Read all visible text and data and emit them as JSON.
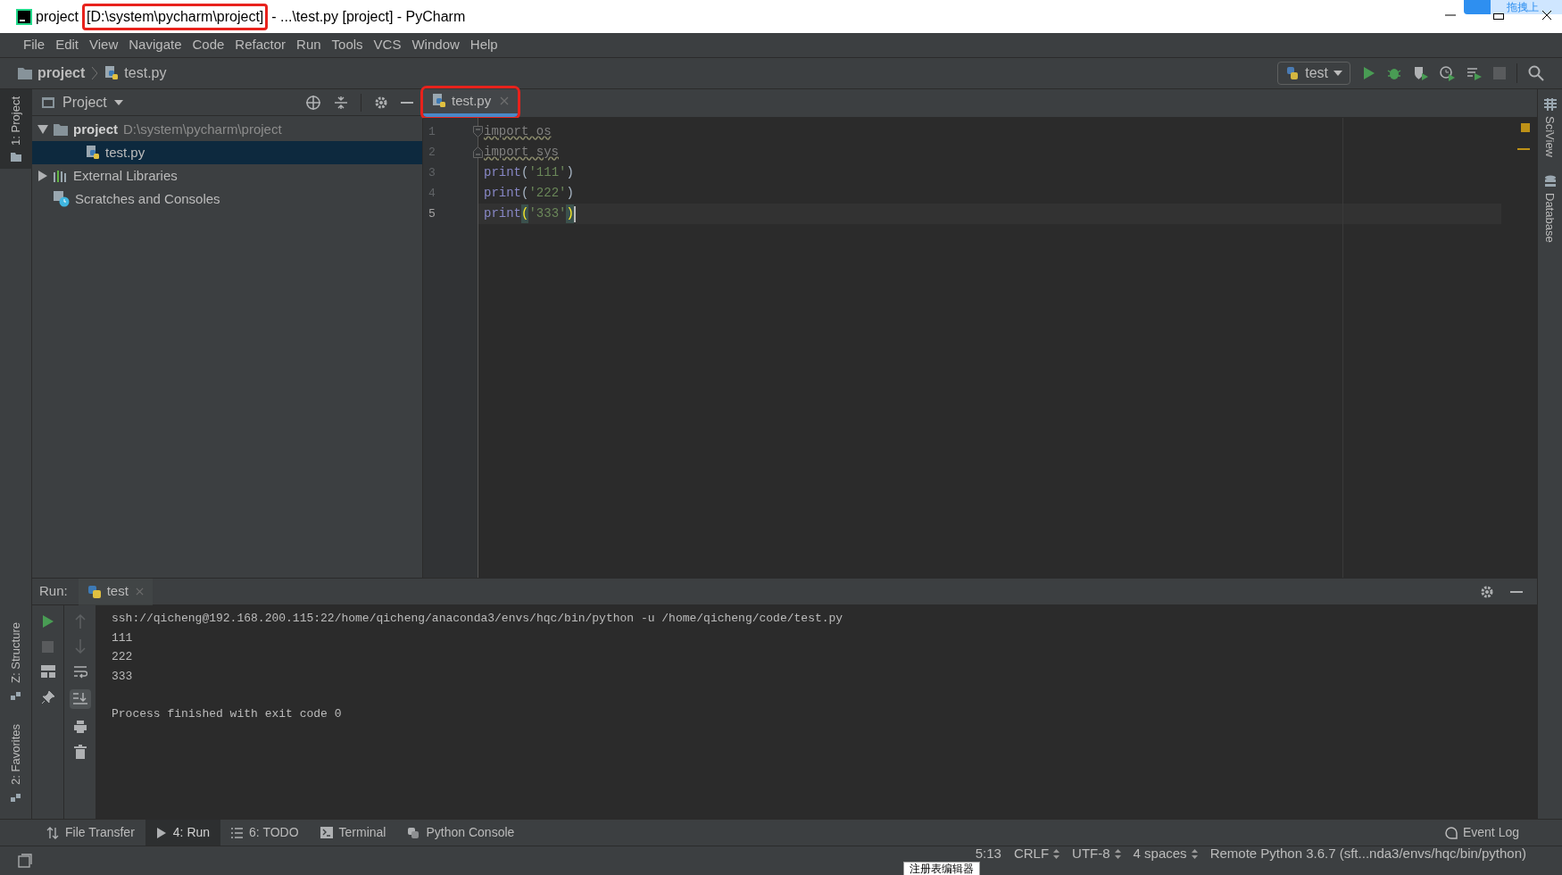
{
  "window": {
    "title": [
      {
        "text": "project",
        "highlighted": false
      },
      {
        "text": "[D:\\system\\pycharm\\project]",
        "highlighted": true
      },
      {
        "text": "- ...\\test.py [project] - PyCharm",
        "highlighted": false
      }
    ]
  },
  "overlay_widget": {
    "label": "拖拽上"
  },
  "menu": [
    "File",
    "Edit",
    "View",
    "Navigate",
    "Code",
    "Refactor",
    "Run",
    "Tools",
    "VCS",
    "Window",
    "Help"
  ],
  "breadcrumbs": [
    {
      "kind": "folder",
      "label": "project"
    },
    {
      "kind": "python",
      "label": "test.py"
    }
  ],
  "run_config": {
    "label": "test"
  },
  "left_stripe_top": [
    {
      "label": "1: Project",
      "selected": true
    }
  ],
  "left_stripe_bottom": [
    {
      "label": "Z: Structure",
      "selected": false
    },
    {
      "label": "2: Favorites",
      "selected": false
    }
  ],
  "right_stripe": [
    {
      "label": "SciView",
      "kind": "grid"
    },
    {
      "label": "Database",
      "kind": "db"
    }
  ],
  "project_panel": {
    "title": "Project",
    "tree": [
      {
        "kind": "folder",
        "label": "project",
        "path": "D:\\system\\pycharm\\project",
        "expanded": true,
        "selected": false,
        "children": [
          {
            "kind": "python",
            "label": "test.py",
            "selected": true
          }
        ]
      },
      {
        "kind": "library",
        "label": "External Libraries",
        "expanded": false,
        "selected": false
      },
      {
        "kind": "scratch",
        "label": "Scratches and Consoles",
        "selected": false
      }
    ]
  },
  "editor": {
    "tabs": [
      {
        "label": "test.py",
        "selected": true,
        "highlighted": true
      }
    ],
    "lines": [
      {
        "number": "1",
        "kind": "fold-start",
        "current": false,
        "tokens": [
          {
            "kind": "unused",
            "text": "import os"
          }
        ]
      },
      {
        "number": "2",
        "kind": "fold-end",
        "current": false,
        "tokens": [
          {
            "kind": "unused",
            "text": "import sys"
          }
        ]
      },
      {
        "number": "3",
        "current": false,
        "tokens": [
          {
            "kind": "func",
            "text": "print"
          },
          {
            "kind": "punct",
            "text": "("
          },
          {
            "kind": "string",
            "text": "'111'"
          },
          {
            "kind": "punct",
            "text": ")"
          }
        ]
      },
      {
        "number": "4",
        "current": false,
        "tokens": [
          {
            "kind": "func",
            "text": "print"
          },
          {
            "kind": "punct",
            "text": "("
          },
          {
            "kind": "string",
            "text": "'222'"
          },
          {
            "kind": "punct",
            "text": ")"
          }
        ]
      },
      {
        "number": "5",
        "current": true,
        "tokens": [
          {
            "kind": "func",
            "text": "print"
          },
          {
            "kind": "match",
            "text": "("
          },
          {
            "kind": "string",
            "text": "'333'"
          },
          {
            "kind": "match",
            "text": ")"
          }
        ]
      }
    ]
  },
  "run_panel": {
    "label": "Run:",
    "tabs": [
      {
        "label": "test",
        "selected": true
      }
    ],
    "output": [
      "ssh://qicheng@192.168.200.115:22/home/qicheng/anaconda3/envs/hqc/bin/python -u /home/qicheng/code/test.py",
      "111",
      "222",
      "333"
    ],
    "exit_message": "Process finished with exit code 0"
  },
  "tool_tabs": [
    {
      "kind": "transfer",
      "label": "File Transfer",
      "selected": false
    },
    {
      "kind": "run",
      "label": "4: Run",
      "selected": true
    },
    {
      "kind": "todo",
      "label": "6: TODO",
      "selected": false
    },
    {
      "kind": "terminal",
      "label": "Terminal",
      "selected": false
    },
    {
      "kind": "python",
      "label": "Python Console",
      "selected": false
    }
  ],
  "event_log": "Event Log",
  "status_bar": [
    "5:13",
    "CRLF",
    "UTF-8",
    "4 spaces",
    "Remote Python 3.6.7 (sft...nda3/envs/hqc/bin/python)"
  ],
  "tooltip": "注册表编辑器"
}
